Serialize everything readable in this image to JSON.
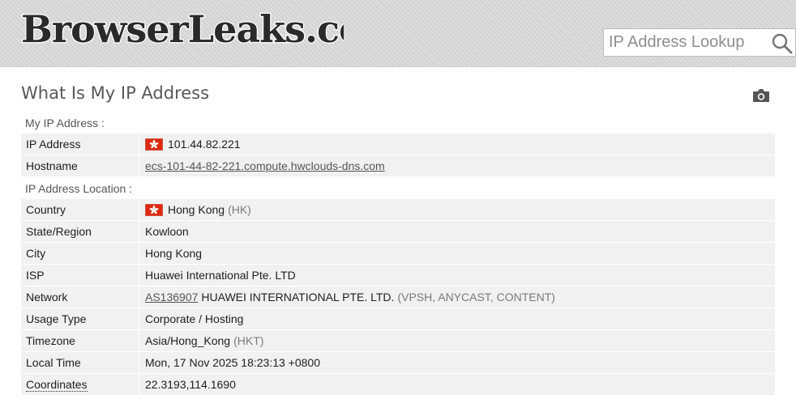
{
  "header": {
    "logo_text": "BrowserLeaks.com",
    "search_placeholder": "IP Address Lookup"
  },
  "page_title": "What Is My IP Address",
  "sections": {
    "my_ip_label": "My IP Address :",
    "location_label": "IP Address Location :"
  },
  "rows": {
    "ip_address": {
      "label": "IP Address",
      "value": "101.44.82.221"
    },
    "hostname": {
      "label": "Hostname",
      "value": "ecs-101-44-82-221.compute.hwclouds-dns.com"
    },
    "country": {
      "label": "Country",
      "value": "Hong Kong",
      "code": "(HK)"
    },
    "state": {
      "label": "State/Region",
      "value": "Kowloon"
    },
    "city": {
      "label": "City",
      "value": "Hong Kong"
    },
    "isp": {
      "label": "ISP",
      "value": "Huawei International Pte. LTD"
    },
    "network": {
      "label": "Network",
      "asn": "AS136907",
      "value": "HUAWEI INTERNATIONAL PTE. LTD.",
      "tags": "(VPSH, ANYCAST, CONTENT)"
    },
    "usage": {
      "label": "Usage Type",
      "value": "Corporate / Hosting"
    },
    "timezone": {
      "label": "Timezone",
      "value": "Asia/Hong_Kong",
      "abbr": "(HKT)"
    },
    "local_time": {
      "label": "Local Time",
      "value": "Mon, 17 Nov 2025 18:23:13 +0800"
    },
    "coordinates": {
      "label": "Coordinates",
      "value": "22.3193,114.1690"
    }
  },
  "colors": {
    "flag_red": "#de2910",
    "header_bg": "#dcdcdc",
    "row_bg": "#f1f1f1"
  },
  "icons": {
    "search": "search-icon",
    "camera": "camera-icon",
    "flag": "hong-kong-flag-icon"
  }
}
